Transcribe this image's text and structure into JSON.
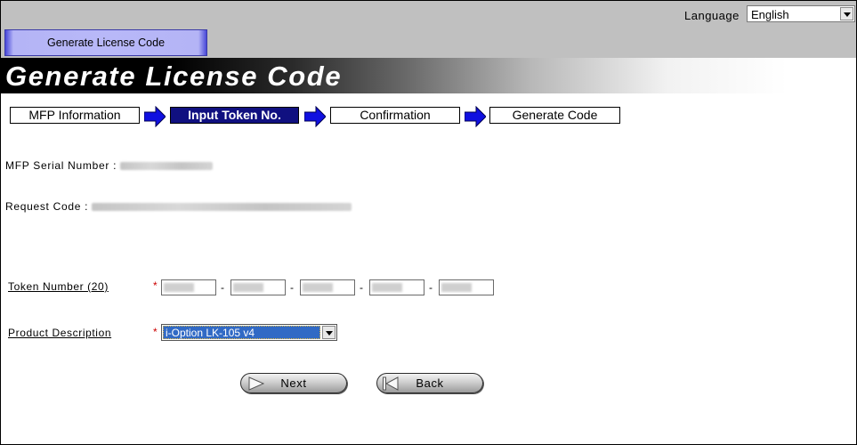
{
  "header": {
    "language_label": "Language",
    "language_value": "English",
    "tab_label": "Generate License Code"
  },
  "page": {
    "title": "Generate License Code"
  },
  "steps": [
    {
      "label": "MFP Information",
      "active": false
    },
    {
      "label": "Input Token No.",
      "active": true
    },
    {
      "label": "Confirmation",
      "active": false
    },
    {
      "label": "Generate Code",
      "active": false
    }
  ],
  "info": {
    "serial_label": "MFP Serial Number :",
    "request_label": "Request Code :"
  },
  "form": {
    "token_label": "Token Number (20)",
    "required_mark": "*",
    "token_separator": "-",
    "product_label": "Product Description",
    "product_value": "i-Option LK-105 v4"
  },
  "buttons": {
    "next": "Next",
    "back": "Back"
  },
  "colors": {
    "active_step_bg": "#101080",
    "arrow_blue": "#1010e0",
    "selection_blue": "#316ac5",
    "required_red": "#cc0000"
  },
  "icons": {
    "step_arrow": "right-arrow-icon",
    "next": "play-icon",
    "back": "back-icon",
    "dropdown": "chevron-down-icon"
  }
}
